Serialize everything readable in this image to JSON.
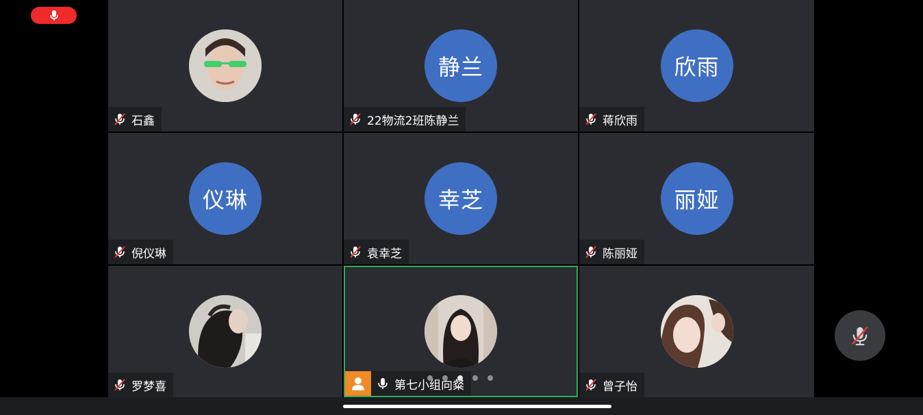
{
  "participants": [
    {
      "display_name": "石鑫",
      "avatar_type": "photo",
      "avatar_text": "",
      "mic": "muted"
    },
    {
      "display_name": "22物流2班陈静兰",
      "avatar_type": "text",
      "avatar_text": "静兰",
      "mic": "muted"
    },
    {
      "display_name": "蒋欣雨",
      "avatar_type": "text",
      "avatar_text": "欣雨",
      "mic": "muted"
    },
    {
      "display_name": "倪仪琳",
      "avatar_type": "text",
      "avatar_text": "仪琳",
      "mic": "muted"
    },
    {
      "display_name": "袁幸芝",
      "avatar_type": "text",
      "avatar_text": "幸芝",
      "mic": "muted"
    },
    {
      "display_name": "陈丽娅",
      "avatar_type": "text",
      "avatar_text": "丽娅",
      "mic": "muted"
    },
    {
      "display_name": "罗梦喜",
      "avatar_type": "photo",
      "avatar_text": "",
      "mic": "muted"
    },
    {
      "display_name": "第七小组向粲",
      "avatar_type": "photo",
      "avatar_text": "",
      "mic": "on",
      "active_speaker": true,
      "host_badge": true
    },
    {
      "display_name": "曾子怡",
      "avatar_type": "photo",
      "avatar_text": "",
      "mic": "muted"
    }
  ],
  "pager": {
    "total_pages": 5,
    "current_page": 3
  },
  "colors": {
    "tile_bg": "#2b2c31",
    "avatar_bg": "#3f6fc2",
    "active_border": "#2fae57",
    "record_pill": "#ee2a2a",
    "host_badge": "#f08a25"
  },
  "icons": {
    "recording": "microphone-icon",
    "muted": "mic-muted-icon",
    "unmuted": "microphone-icon",
    "host": "person-icon",
    "self_mic": "mic-muted-icon"
  }
}
